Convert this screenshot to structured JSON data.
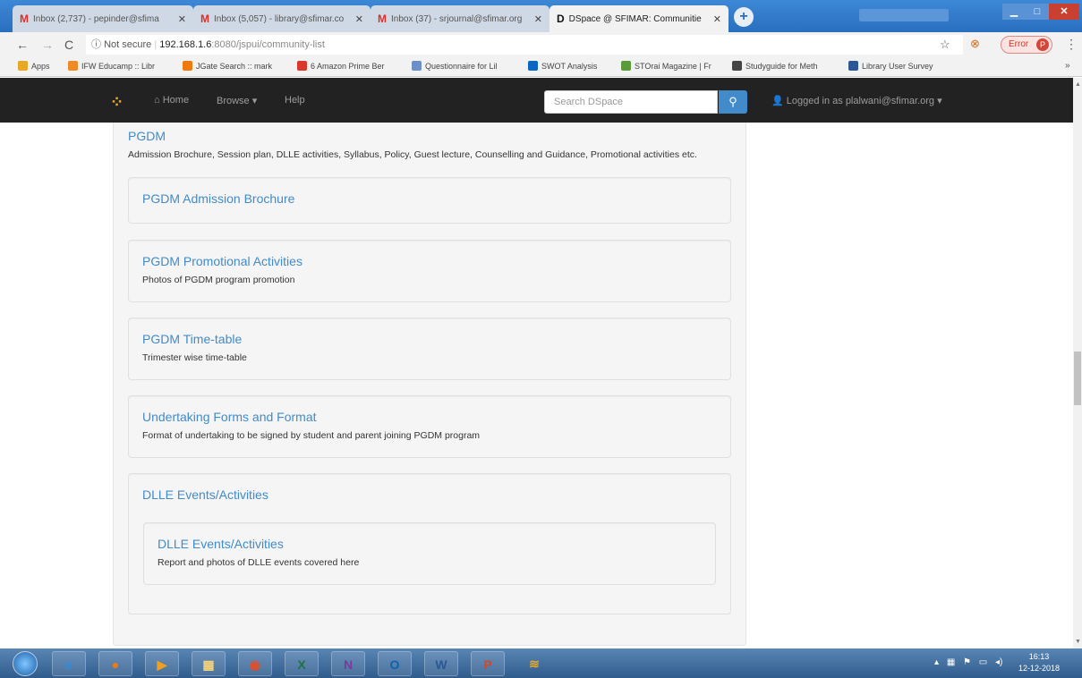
{
  "browser": {
    "tabs": [
      {
        "title": "Inbox (2,737) - pepinder@sfima",
        "icon": "gmail-icon",
        "active": false
      },
      {
        "title": "Inbox (5,057) - library@sfimar.co",
        "icon": "gmail-icon",
        "active": false
      },
      {
        "title": "Inbox (37) - srjournal@sfimar.org",
        "icon": "gmail-icon",
        "active": false
      },
      {
        "title": "DSpace @ SFIMAR: Communitie",
        "icon": "dspace-icon",
        "active": true
      }
    ],
    "url": {
      "security": "Not secure",
      "host": "192.168.1.6",
      "path": ":8080/jspui/community-list"
    },
    "error_button": "Error",
    "profile_initial": "P",
    "bookmarks": [
      {
        "label": "Apps",
        "color": "#e8a825"
      },
      {
        "label": "IFW Educamp :: Libr",
        "color": "#f08a24"
      },
      {
        "label": "JGate Search :: mark",
        "color": "#f07a10"
      },
      {
        "label": "6 Amazon Prime Ber",
        "color": "#d9382b"
      },
      {
        "label": "Questionnaire for Lil",
        "color": "#6a8fc9"
      },
      {
        "label": "SWOT Analysis",
        "color": "#0a66c2"
      },
      {
        "label": "STOrai Magazine | Fr",
        "color": "#5a9c3a"
      },
      {
        "label": "Studyguide for Meth",
        "color": "#444444"
      },
      {
        "label": "Library User Survey",
        "color": "#2b5797"
      }
    ]
  },
  "dspace_nav": {
    "home": "Home",
    "browse": "Browse",
    "help": "Help",
    "search_placeholder": "Search DSpace",
    "logged_in": "Logged in as plalwani@sfimar.org"
  },
  "community": {
    "title": "PGDM",
    "description": "Admission Brochure, Session plan, DLLE activities, Syllabus, Policy, Guest lecture, Counselling and Guidance, Promotional activities etc.",
    "subcommunities": [
      {
        "title": "PGDM Admission Brochure",
        "description": ""
      },
      {
        "title": "PGDM Promotional Activities",
        "description": "Photos of PGDM program promotion"
      },
      {
        "title": "PGDM Time-table",
        "description": "Trimester wise time-table"
      },
      {
        "title": "Undertaking Forms and Format",
        "description": "Format of undertaking to be signed by student and parent joining PGDM program"
      },
      {
        "title": "DLLE Events/Activities",
        "description": ""
      }
    ],
    "nested": {
      "title": "DLLE Events/Activities",
      "description": "Report and photos of DLLE events covered here"
    }
  },
  "taskbar": {
    "apps": [
      {
        "name": "ie-icon",
        "glyph": "e",
        "color": "#2b8ee0"
      },
      {
        "name": "firefox-icon",
        "glyph": "●",
        "color": "#f07a10"
      },
      {
        "name": "media-player-icon",
        "glyph": "▶",
        "color": "#f0a020"
      },
      {
        "name": "file-explorer-icon",
        "glyph": "▦",
        "color": "#f5d37a"
      },
      {
        "name": "chrome-icon",
        "glyph": "◉",
        "color": "#e44d26"
      },
      {
        "name": "excel-icon",
        "glyph": "X",
        "color": "#1f7244"
      },
      {
        "name": "onenote-icon",
        "glyph": "N",
        "color": "#7a3b9a"
      },
      {
        "name": "outlook-icon",
        "glyph": "O",
        "color": "#0a64ad"
      },
      {
        "name": "word-icon",
        "glyph": "W",
        "color": "#2b5797"
      },
      {
        "name": "powerpoint-icon",
        "glyph": "P",
        "color": "#d24726"
      },
      {
        "name": "stack-app-icon",
        "glyph": "≋",
        "color": "#e8a825"
      }
    ],
    "time": "16:13",
    "date": "12-12-2018"
  }
}
